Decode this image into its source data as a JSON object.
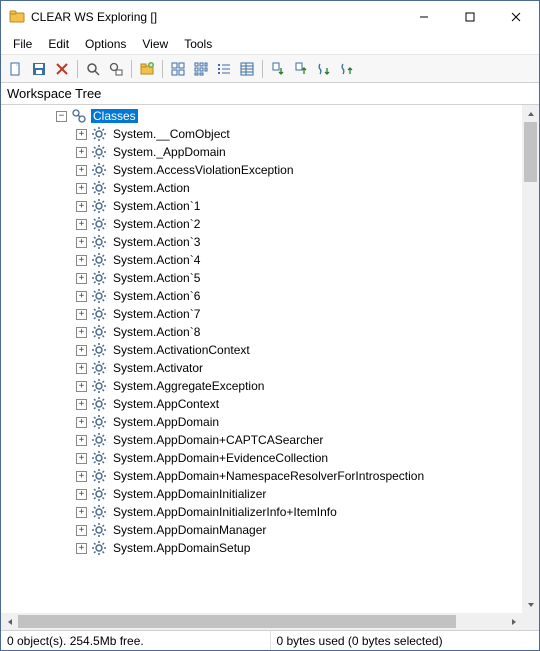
{
  "window": {
    "title": "CLEAR WS Exploring []"
  },
  "menu": {
    "items": [
      "File",
      "Edit",
      "Options",
      "View",
      "Tools"
    ]
  },
  "toolbar": {
    "buttons": [
      {
        "name": "new-icon"
      },
      {
        "name": "save-icon"
      },
      {
        "name": "delete-icon"
      },
      {
        "name": "search-icon"
      },
      {
        "name": "replace-icon"
      }
    ],
    "buttons2": [
      {
        "name": "new-folder-icon"
      }
    ],
    "buttons3": [
      {
        "name": "view-large-icon"
      },
      {
        "name": "view-small-icon"
      },
      {
        "name": "view-list-icon"
      },
      {
        "name": "view-details-icon"
      }
    ],
    "buttons4": [
      {
        "name": "sort-name-asc-icon"
      },
      {
        "name": "sort-name-desc-icon"
      },
      {
        "name": "sort-size-asc-icon"
      },
      {
        "name": "sort-size-desc-icon"
      }
    ]
  },
  "tree_header": "Workspace Tree",
  "tree": {
    "root": {
      "label": "Classes",
      "expanded": true,
      "selected": true,
      "children": [
        "System.__ComObject",
        "System._AppDomain",
        "System.AccessViolationException",
        "System.Action",
        "System.Action`1",
        "System.Action`2",
        "System.Action`3",
        "System.Action`4",
        "System.Action`5",
        "System.Action`6",
        "System.Action`7",
        "System.Action`8",
        "System.ActivationContext",
        "System.Activator",
        "System.AggregateException",
        "System.AppContext",
        "System.AppDomain",
        "System.AppDomain+CAPTCASearcher",
        "System.AppDomain+EvidenceCollection",
        "System.AppDomain+NamespaceResolverForIntrospection",
        "System.AppDomainInitializer",
        "System.AppDomainInitializerInfo+ItemInfo",
        "System.AppDomainManager",
        "System.AppDomainSetup"
      ]
    }
  },
  "status": {
    "left": "0 object(s). 254.5Mb free.",
    "right": "0 bytes used (0 bytes selected)"
  }
}
